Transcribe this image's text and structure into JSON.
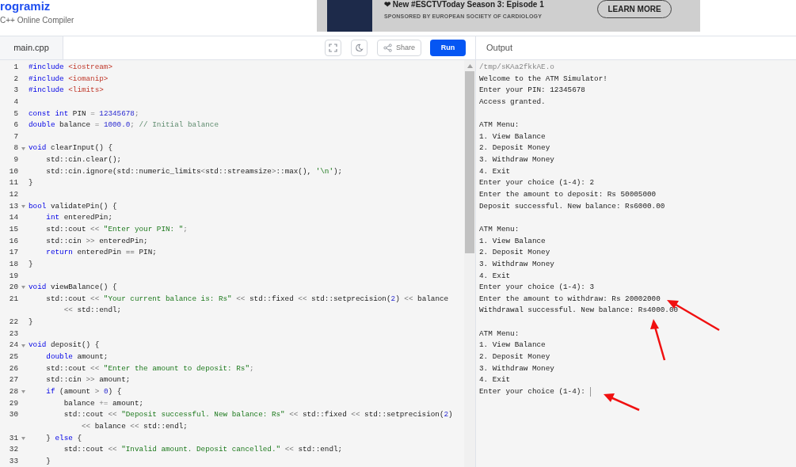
{
  "header": {
    "logo": "rogramiz",
    "subtitle": "C++ Online Compiler"
  },
  "ad": {
    "headline": "❤ New #ESCTVToday Season 3: Episode 1",
    "sponsor": "SPONSORED BY EUROPEAN SOCIETY OF CARDIOLOGY",
    "button": "LEARN MORE"
  },
  "toolbar": {
    "file_tab": "main.cpp",
    "share": "Share",
    "run": "Run",
    "output_title": "Output"
  },
  "code_lines": [
    {
      "number": "1",
      "fold": false,
      "tokens": [
        {
          "kind": "kw",
          "text": "#include"
        },
        {
          "kind": "inc",
          "text": " <iostream>"
        }
      ]
    },
    {
      "number": "2",
      "fold": false,
      "tokens": [
        {
          "kind": "kw",
          "text": "#include"
        },
        {
          "kind": "inc",
          "text": " <iomanip>"
        }
      ]
    },
    {
      "number": "3",
      "fold": false,
      "tokens": [
        {
          "kind": "kw",
          "text": "#include"
        },
        {
          "kind": "inc",
          "text": " <limits>"
        }
      ]
    },
    {
      "number": "4",
      "fold": false
    },
    {
      "number": "5",
      "fold": false,
      "tokens": [
        {
          "kind": "kw",
          "text": "const int"
        },
        {
          "kind": "plain",
          "text": " PIN "
        },
        {
          "kind": "op",
          "text": "="
        },
        {
          "kind": "num",
          "text": " 12345678"
        },
        {
          "kind": "op",
          "text": ";"
        }
      ]
    },
    {
      "number": "6",
      "fold": false,
      "tokens": [
        {
          "kind": "kw",
          "text": "double"
        },
        {
          "kind": "plain",
          "text": " balance "
        },
        {
          "kind": "op",
          "text": "="
        },
        {
          "kind": "num",
          "text": " 1000.0"
        },
        {
          "kind": "op",
          "text": ";"
        },
        {
          "kind": "cm",
          "text": " // Initial balance"
        }
      ]
    },
    {
      "number": "7",
      "fold": false
    },
    {
      "number": "8",
      "fold": true,
      "tokens": [
        {
          "kind": "kw",
          "text": "void"
        },
        {
          "kind": "plain",
          "text": " clearInput() {"
        }
      ]
    },
    {
      "number": "9",
      "fold": false,
      "tokens": [
        {
          "kind": "plain",
          "text": "    std::cin.clear();"
        }
      ]
    },
    {
      "number": "10",
      "fold": false,
      "tokens": [
        {
          "kind": "plain",
          "text": "    std::cin.ignore(std::numeric_limits"
        },
        {
          "kind": "op",
          "text": "<"
        },
        {
          "kind": "plain",
          "text": "std::streamsize"
        },
        {
          "kind": "op",
          "text": ">"
        },
        {
          "kind": "plain",
          "text": "::max(), "
        },
        {
          "kind": "str",
          "text": "'\\n'"
        },
        {
          "kind": "plain",
          "text": ");"
        }
      ]
    },
    {
      "number": "11",
      "fold": false,
      "tokens": [
        {
          "kind": "plain",
          "text": "}"
        }
      ]
    },
    {
      "number": "12",
      "fold": false
    },
    {
      "number": "13",
      "fold": true,
      "tokens": [
        {
          "kind": "kw",
          "text": "bool"
        },
        {
          "kind": "plain",
          "text": " validatePin() {"
        }
      ]
    },
    {
      "number": "14",
      "fold": false,
      "tokens": [
        {
          "kind": "kw",
          "text": "    int"
        },
        {
          "kind": "plain",
          "text": " enteredPin;"
        }
      ]
    },
    {
      "number": "15",
      "fold": false,
      "tokens": [
        {
          "kind": "plain",
          "text": "    std::cout "
        },
        {
          "kind": "op",
          "text": "<<"
        },
        {
          "kind": "str",
          "text": " \"Enter your PIN: \""
        },
        {
          "kind": "op",
          "text": ";"
        }
      ]
    },
    {
      "number": "16",
      "fold": false,
      "tokens": [
        {
          "kind": "plain",
          "text": "    std::cin "
        },
        {
          "kind": "op",
          "text": ">>"
        },
        {
          "kind": "plain",
          "text": " enteredPin;"
        }
      ]
    },
    {
      "number": "17",
      "fold": false,
      "tokens": [
        {
          "kind": "kw",
          "text": "    return"
        },
        {
          "kind": "plain",
          "text": " enteredPin == PIN;"
        }
      ]
    },
    {
      "number": "18",
      "fold": false,
      "tokens": [
        {
          "kind": "plain",
          "text": "}"
        }
      ]
    },
    {
      "number": "19",
      "fold": false
    },
    {
      "number": "20",
      "fold": true,
      "tokens": [
        {
          "kind": "kw",
          "text": "void"
        },
        {
          "kind": "plain",
          "text": " viewBalance() {"
        }
      ]
    },
    {
      "number": "21",
      "fold": false,
      "tokens": [
        {
          "kind": "plain",
          "text": "    std::cout "
        },
        {
          "kind": "op",
          "text": "<<"
        },
        {
          "kind": "str",
          "text": " \"Your current balance is: Rs\""
        },
        {
          "kind": "op",
          "text": " <<"
        },
        {
          "kind": "plain",
          "text": " std::fixed "
        },
        {
          "kind": "op",
          "text": "<<"
        },
        {
          "kind": "plain",
          "text": " std::setprecision("
        },
        {
          "kind": "num",
          "text": "2"
        },
        {
          "kind": "plain",
          "text": ") "
        },
        {
          "kind": "op",
          "text": "<<"
        },
        {
          "kind": "plain",
          "text": " balance"
        }
      ],
      "wrapped": [
        {
          "kind": "op",
          "text": "        <<"
        },
        {
          "kind": "plain",
          "text": " std::endl;"
        }
      ]
    },
    {
      "number": "22",
      "fold": false,
      "tokens": [
        {
          "kind": "plain",
          "text": "}"
        }
      ]
    },
    {
      "number": "23",
      "fold": false
    },
    {
      "number": "24",
      "fold": true,
      "tokens": [
        {
          "kind": "kw",
          "text": "void"
        },
        {
          "kind": "plain",
          "text": " deposit() {"
        }
      ]
    },
    {
      "number": "25",
      "fold": false,
      "tokens": [
        {
          "kind": "kw",
          "text": "    double"
        },
        {
          "kind": "plain",
          "text": " amount;"
        }
      ]
    },
    {
      "number": "26",
      "fold": false,
      "tokens": [
        {
          "kind": "plain",
          "text": "    std::cout "
        },
        {
          "kind": "op",
          "text": "<<"
        },
        {
          "kind": "str",
          "text": " \"Enter the amount to deposit: Rs\""
        },
        {
          "kind": "op",
          "text": ";"
        }
      ]
    },
    {
      "number": "27",
      "fold": false,
      "tokens": [
        {
          "kind": "plain",
          "text": "    std::cin "
        },
        {
          "kind": "op",
          "text": ">>"
        },
        {
          "kind": "plain",
          "text": " amount;"
        }
      ]
    },
    {
      "number": "28",
      "fold": true,
      "tokens": [
        {
          "kind": "kw",
          "text": "    if"
        },
        {
          "kind": "plain",
          "text": " (amount "
        },
        {
          "kind": "op",
          "text": ">"
        },
        {
          "kind": "num",
          "text": " 0"
        },
        {
          "kind": "plain",
          "text": ") {"
        }
      ]
    },
    {
      "number": "29",
      "fold": false,
      "tokens": [
        {
          "kind": "plain",
          "text": "        balance "
        },
        {
          "kind": "op",
          "text": "+="
        },
        {
          "kind": "plain",
          "text": " amount;"
        }
      ]
    },
    {
      "number": "30",
      "fold": false,
      "tokens": [
        {
          "kind": "plain",
          "text": "        std::cout "
        },
        {
          "kind": "op",
          "text": "<<"
        },
        {
          "kind": "str",
          "text": " \"Deposit successful. New balance: Rs\""
        },
        {
          "kind": "op",
          "text": " <<"
        },
        {
          "kind": "plain",
          "text": " std::fixed "
        },
        {
          "kind": "op",
          "text": "<<"
        },
        {
          "kind": "plain",
          "text": " std::setprecision("
        },
        {
          "kind": "num",
          "text": "2"
        },
        {
          "kind": "plain",
          "text": ")"
        }
      ],
      "wrapped": [
        {
          "kind": "op",
          "text": "            <<"
        },
        {
          "kind": "plain",
          "text": " balance "
        },
        {
          "kind": "op",
          "text": "<<"
        },
        {
          "kind": "plain",
          "text": " std::endl;"
        }
      ]
    },
    {
      "number": "31",
      "fold": true,
      "tokens": [
        {
          "kind": "plain",
          "text": "    }"
        },
        {
          "kind": "kw",
          "text": " else"
        },
        {
          "kind": "plain",
          "text": " {"
        }
      ]
    },
    {
      "number": "32",
      "fold": false,
      "tokens": [
        {
          "kind": "plain",
          "text": "        std::cout "
        },
        {
          "kind": "op",
          "text": "<<"
        },
        {
          "kind": "str",
          "text": " \"Invalid amount. Deposit cancelled.\""
        },
        {
          "kind": "op",
          "text": " <<"
        },
        {
          "kind": "plain",
          "text": " std::endl;"
        }
      ]
    },
    {
      "number": "33",
      "fold": false,
      "tokens": [
        {
          "kind": "plain",
          "text": "    }"
        }
      ]
    }
  ],
  "output_lines": [
    {
      "kind": "path",
      "text": "/tmp/sKAa2fkkAE.o"
    },
    {
      "kind": "text",
      "text": "Welcome to the ATM Simulator!"
    },
    {
      "kind": "text",
      "text": "Enter your PIN: 12345678"
    },
    {
      "kind": "text",
      "text": "Access granted."
    },
    {
      "kind": "blank"
    },
    {
      "kind": "text",
      "text": "ATM Menu:"
    },
    {
      "kind": "text",
      "text": "1. View Balance"
    },
    {
      "kind": "text",
      "text": "2. Deposit Money"
    },
    {
      "kind": "text",
      "text": "3. Withdraw Money"
    },
    {
      "kind": "text",
      "text": "4. Exit"
    },
    {
      "kind": "text",
      "text": "Enter your choice (1-4): 2"
    },
    {
      "kind": "text",
      "text": "Enter the amount to deposit: Rs 50005000"
    },
    {
      "kind": "text",
      "text": "Deposit successful. New balance: Rs6000.00"
    },
    {
      "kind": "blank"
    },
    {
      "kind": "text",
      "text": "ATM Menu:"
    },
    {
      "kind": "text",
      "text": "1. View Balance"
    },
    {
      "kind": "text",
      "text": "2. Deposit Money"
    },
    {
      "kind": "text",
      "text": "3. Withdraw Money"
    },
    {
      "kind": "text",
      "text": "4. Exit"
    },
    {
      "kind": "text",
      "text": "Enter your choice (1-4): 3"
    },
    {
      "kind": "text",
      "text": "Enter the amount to withdraw: Rs 20002000"
    },
    {
      "kind": "text",
      "text": "Withdrawal successful. New balance: Rs4000.00"
    },
    {
      "kind": "blank"
    },
    {
      "kind": "text",
      "text": "ATM Menu:"
    },
    {
      "kind": "text",
      "text": "1. View Balance"
    },
    {
      "kind": "text",
      "text": "2. Deposit Money"
    },
    {
      "kind": "text",
      "text": "3. Withdraw Money"
    },
    {
      "kind": "text",
      "text": "4. Exit"
    },
    {
      "kind": "prompt",
      "text": "Enter your choice (1-4):"
    }
  ]
}
